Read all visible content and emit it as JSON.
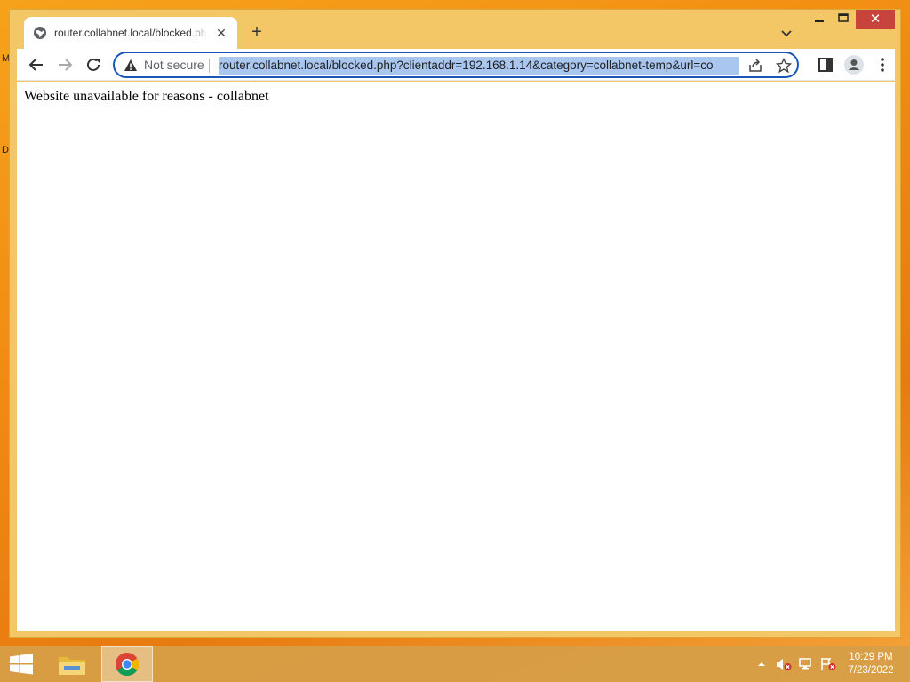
{
  "desktop": {
    "partial_labels": [
      "M",
      "D"
    ]
  },
  "tab": {
    "title": "router.collabnet.local/blocked.php"
  },
  "omnibox": {
    "security_label": "Not secure",
    "url": "router.collabnet.local/blocked.php?clientaddr=192.168.1.14&category=collabnet-temp&url=co"
  },
  "page": {
    "message": "Website unavailable for reasons - collabnet"
  },
  "taskbar": {
    "time": "10:29 PM",
    "date": "7/23/2022"
  },
  "colors": {
    "titlebar": "#f3c766",
    "close_button": "#c7433b",
    "omnibox_focus": "#1a56b8",
    "url_selection": "#a9c6ef"
  }
}
